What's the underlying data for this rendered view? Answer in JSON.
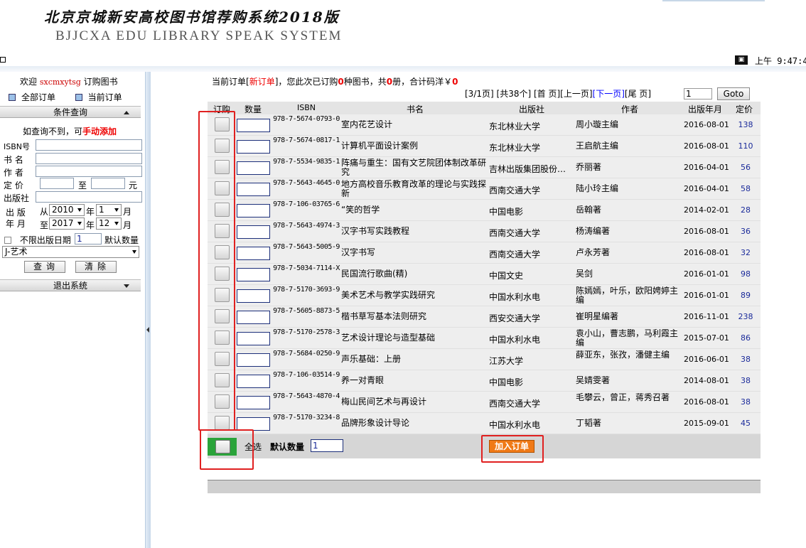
{
  "header": {
    "title": "北京京城新安高校图书馆荐购系统2018版",
    "subtitle": "BJJCXA EDU LIBRARY SPEAK SYSTEM"
  },
  "statusbar": {
    "time": "上午 9:47:42"
  },
  "sidebar": {
    "welcome_prefix": "欢迎",
    "username": "sxcmxytsg",
    "welcome_suffix": "订购图书",
    "all_orders": "全部订单",
    "current_orders": "当前订单",
    "condition_query": "条件查询",
    "manual_prefix": "如查询不到，可",
    "manual_link": "手动添加",
    "isbn_label": "ISBN号",
    "title_label": "书 名",
    "author_label": "作 者",
    "price_label": "定 价",
    "price_to": "至",
    "price_unit": "元",
    "publisher_label": "出版社",
    "pubdate_label_1": "出 版",
    "pubdate_label_2": "年 月",
    "from": "从",
    "to": "至",
    "year": "年",
    "month": "月",
    "from_year": "2010",
    "from_month": "1",
    "to_year": "2017",
    "to_month": "12",
    "unlimited_date": "不限出版日期",
    "default_qty_value": "1",
    "default_qty_label": "默认数量",
    "category": "J-艺术",
    "query_button": "查询",
    "clear_button": "清除",
    "logout": "退出系统"
  },
  "main": {
    "info": {
      "prefix": "当前订单[",
      "new_order": "新订单",
      "mid1": "]，您此次已订购",
      "count": "0",
      "mid2": "种图书，共",
      "volumes": "0",
      "mid3": "册，合计码洋￥",
      "total": "0"
    },
    "pager": {
      "page": "[3/1页]",
      "total": "[共38个]",
      "first": "[首 页]",
      "prev": "[上一页]",
      "next": "[下一页]",
      "last": "[尾 页]",
      "input": "1",
      "goto": "Goto"
    },
    "columns": {
      "order": "订购",
      "qty": "数量",
      "isbn": "ISBN",
      "title": "书名",
      "publisher": "出版社",
      "author": "作者",
      "date": "出版年月",
      "price": "定价"
    },
    "rows": [
      {
        "isbn": "978-7-5674-0793-0",
        "title": "室内花艺设计",
        "publisher": "东北林业大学",
        "author": "周小璇主编",
        "date": "2016-08-01",
        "price": "138"
      },
      {
        "isbn": "978-7-5674-0817-1",
        "title": "计算机平面设计案例",
        "publisher": "东北林业大学",
        "author": "王启航主编",
        "date": "2016-08-01",
        "price": "110"
      },
      {
        "isbn": "978-7-5534-9835-1",
        "title": "阵痛与重生：国有文艺院团体制改革研究",
        "publisher": "吉林出版集团股份…",
        "author": "乔丽著",
        "date": "2016-04-01",
        "price": "56"
      },
      {
        "isbn": "978-7-5643-4645-0",
        "title": "地方高校音乐教育改革的理论与实践探新",
        "publisher": "西南交通大学",
        "author": "陆小玲主编",
        "date": "2016-04-01",
        "price": "58"
      },
      {
        "isbn": "978-7-106-03765-6",
        "title": "“笑的哲学",
        "publisher": "中国电影",
        "author": "岳翰著",
        "date": "2014-02-01",
        "price": "28"
      },
      {
        "isbn": "978-7-5643-4974-3",
        "title": "汉字书写实践教程",
        "publisher": "西南交通大学",
        "author": "杨涛编著",
        "date": "2016-08-01",
        "price": "36"
      },
      {
        "isbn": "978-7-5643-5005-9",
        "title": "汉字书写",
        "publisher": "西南交通大学",
        "author": "卢永芳著",
        "date": "2016-08-01",
        "price": "32"
      },
      {
        "isbn": "978-7-5034-7114-X",
        "title": "民国流行歌曲(精)",
        "publisher": "中国文史",
        "author": "吴剑",
        "date": "2016-01-01",
        "price": "98"
      },
      {
        "isbn": "978-7-5170-3693-9",
        "title": "美术艺术与教学实践研究",
        "publisher": "中国水利水电",
        "author": "陈嫣嫣，叶乐，欧阳娉婷主编",
        "date": "2016-01-01",
        "price": "89"
      },
      {
        "isbn": "978-7-5605-8873-5",
        "title": "楷书草写基本法则研究",
        "publisher": "西安交通大学",
        "author": "崔明星编著",
        "date": "2016-11-01",
        "price": "238"
      },
      {
        "isbn": "978-7-5170-2578-3",
        "title": "艺术设计理论与造型基础",
        "publisher": "中国水利水电",
        "author": "袁小山，曹志鹏，马利霞主编",
        "date": "2015-07-01",
        "price": "86"
      },
      {
        "isbn": "978-7-5684-0250-9",
        "title": "声乐基础：上册",
        "publisher": "江苏大学",
        "author": "薛亚东，张孜，潘健主编",
        "date": "2016-06-01",
        "price": "38"
      },
      {
        "isbn": "978-7-106-03514-9",
        "title": "养一对青眼",
        "publisher": "中国电影",
        "author": "吴婧雯著",
        "date": "2014-08-01",
        "price": "38"
      },
      {
        "isbn": "978-7-5643-4870-4",
        "title": "梅山民间艺术与再设计",
        "publisher": "西南交通大学",
        "author": "毛攀云，曾正，蒋秀召著",
        "date": "2016-08-01",
        "price": "38"
      },
      {
        "isbn": "978-7-5170-3234-8",
        "title": "品牌形象设计导论",
        "publisher": "中国水利水电",
        "author": "丁韬著",
        "date": "2015-09-01",
        "price": "45"
      }
    ],
    "footer": {
      "select_all": "全选",
      "default_qty_label": "默认数量",
      "default_qty_value": "1",
      "add_to_order": "加入订单"
    }
  },
  "colors": {
    "highlight": "#e02020",
    "add_button": "#f07a17",
    "select_all_bg": "#2aa33a",
    "accent_red": "#e00000",
    "price_blue": "#1a2a9a"
  }
}
